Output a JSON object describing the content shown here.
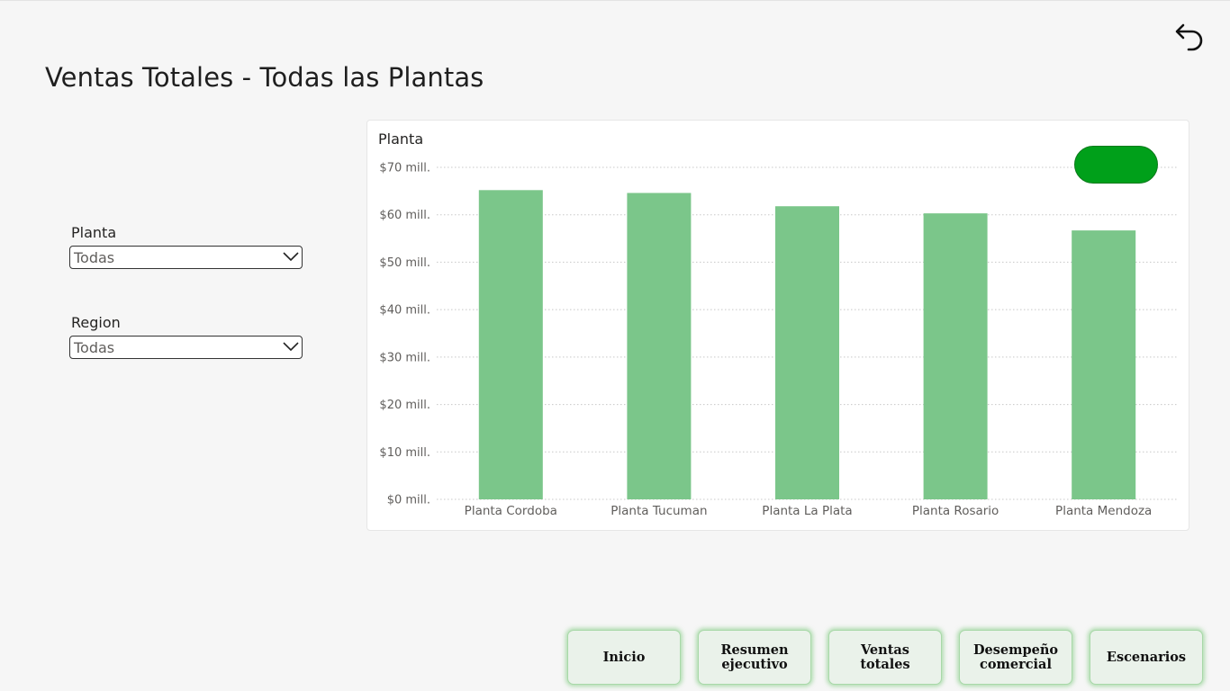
{
  "header": {
    "title": "Ventas Totales - Todas las Plantas",
    "back_icon": "undo-arrow-icon"
  },
  "filters": {
    "planta": {
      "label": "Planta",
      "value": "Todas"
    },
    "region": {
      "label": "Region",
      "value": "Todas"
    }
  },
  "chart_data": {
    "type": "bar",
    "title": "Planta",
    "categories": [
      "Planta Cordoba",
      "Planta Tucuman",
      "Planta La Plata",
      "Planta Rosario",
      "Planta Mendoza"
    ],
    "values": [
      65.2,
      64.6,
      61.8,
      60.3,
      56.7
    ],
    "unit": "millions",
    "ylim": [
      0,
      70
    ],
    "yticks": [
      {
        "value": 0,
        "label": "$0 mill."
      },
      {
        "value": 10,
        "label": "$10 mill."
      },
      {
        "value": 20,
        "label": "$20 mill."
      },
      {
        "value": 30,
        "label": "$30 mill."
      },
      {
        "value": 40,
        "label": "$40 mill."
      },
      {
        "value": 50,
        "label": "$50 mill."
      },
      {
        "value": 60,
        "label": "$60 mill."
      },
      {
        "value": 70,
        "label": "$70 mill."
      }
    ],
    "grid": true,
    "bar_color": "#7bc68a",
    "toggle_color": "#00a01a"
  },
  "nav": {
    "inicio": "Inicio",
    "resumen": "Resumen\nejecutivo",
    "ventas": "Ventas\ntotales",
    "desempeno": "Desempeño\ncomercial",
    "escenarios": "Escenarios"
  }
}
